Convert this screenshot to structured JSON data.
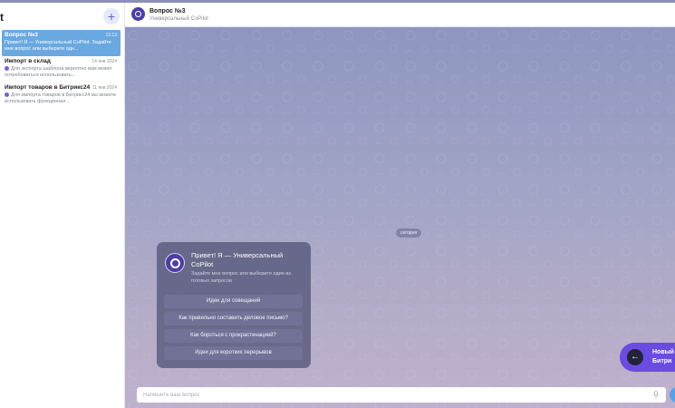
{
  "sidebar": {
    "title": "t",
    "add_label": "+",
    "chats": [
      {
        "title": "Вопрос №3",
        "date": "13:13",
        "preview": "Привет! Я — Универсальный CoPilot. Задайте мне вопрос или выберите одн...",
        "active": true
      },
      {
        "title": "Импорт в склад",
        "date": "14 янв 2024",
        "preview": "Для экспорта шаблона вероятно вам может потребоваться использовать...",
        "active": false
      },
      {
        "title": "Импорт товаров в Битрикс24",
        "date": "11 янв 2024",
        "preview": "Для импорта товаров в Битрикс24 вы можете использовать функционал...",
        "active": false
      }
    ]
  },
  "header": {
    "title": "Вопрос №3",
    "subtitle": "Универсальный CoPilot"
  },
  "chat": {
    "date_label": "сегодня",
    "welcome": {
      "title": "Привет! Я — Универсальный CoPilot",
      "subtitle": "Задайте мне вопрос или выберите один из готовых запросов",
      "buttons": [
        "Идеи для совещаний",
        "Как правильно составить деловое письмо?",
        "Как бороться с прокрастинацией?",
        "Идеи для коротких перерывов"
      ]
    },
    "new_chat": {
      "line1": "Новый",
      "line2": "Битри"
    }
  },
  "input": {
    "placeholder": "Напишите ваш вопрос"
  },
  "colors": {
    "accent": "#6a4ce0",
    "active_chat": "#6aa8e0",
    "avatar": "#4c3fa3"
  }
}
